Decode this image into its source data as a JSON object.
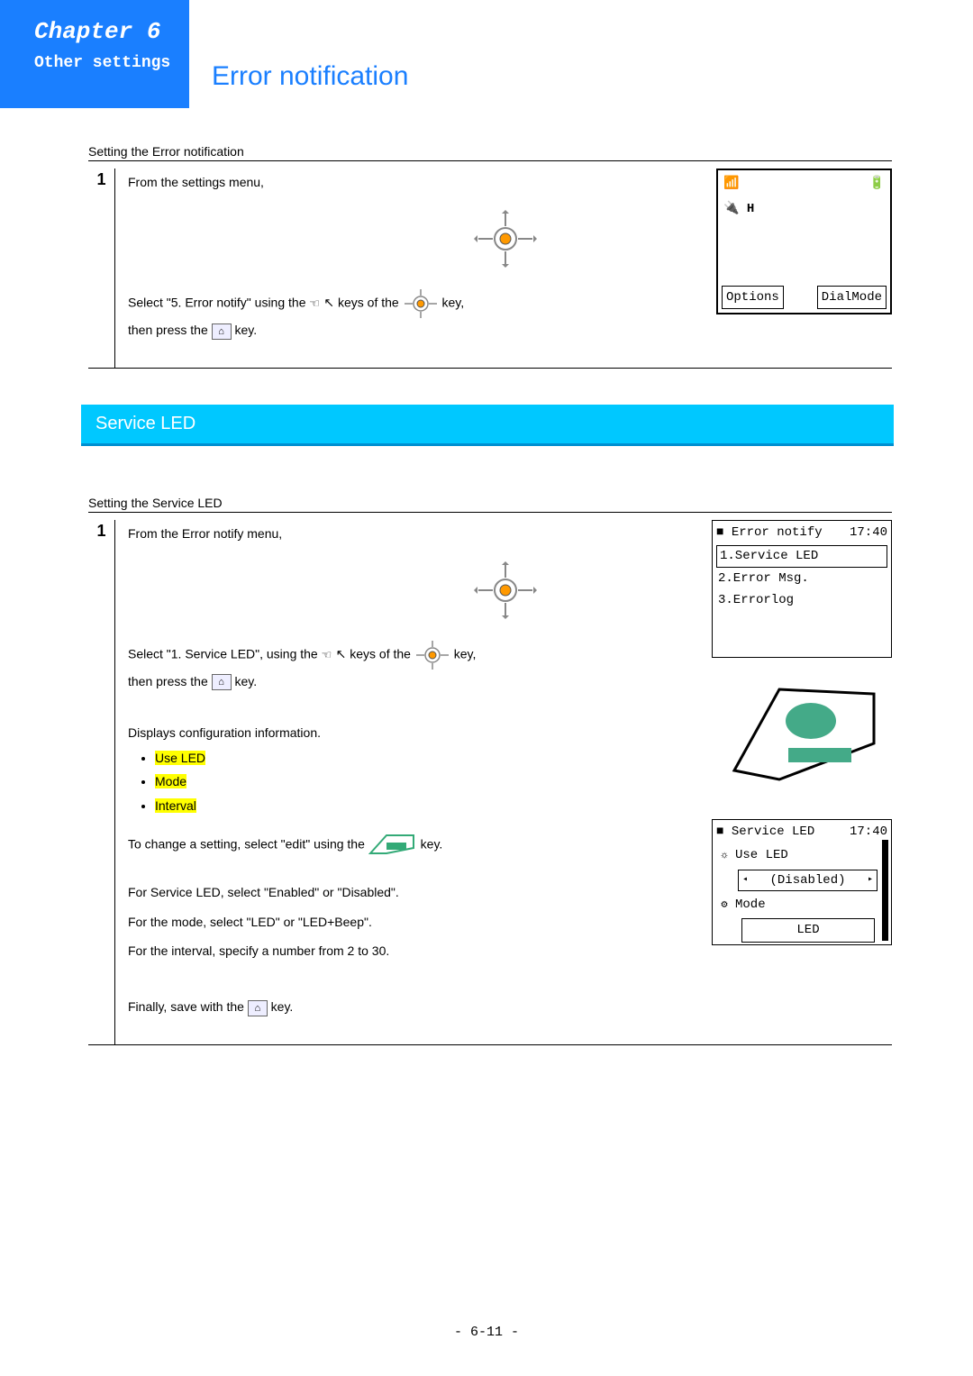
{
  "header": {
    "chapter": "Chapter 6",
    "subtitle": "Other settings",
    "main_title": "Error notification"
  },
  "section1": {
    "label": "Setting the Error notification",
    "step_num": "1",
    "line1": "From the settings menu,",
    "line2a": "Select \"5. Error notify\" using the ",
    "line2b": " keys of the ",
    "line2c": " key,",
    "line3a": "then press the ",
    "line3b": " key.",
    "screen": {
      "slot": "H",
      "btn_left": "Options",
      "btn_right": "DialMode"
    }
  },
  "blue_bar": "Service  LED",
  "section2": {
    "label": "Setting the Service LED",
    "step_num": "1",
    "line1": "From the Error notify menu,",
    "line2a": "Select \"1. Service LED\", using the ",
    "line2b": " keys of the ",
    "line2c": " key,",
    "line3a": "then press the ",
    "line3b": " key.",
    "disp": "Displays configuration information.",
    "bullets": [
      "Use LED",
      "Mode",
      "Interval"
    ],
    "change_a": "To change a setting, select \"edit\" using the ",
    "change_b": " key.",
    "l_serv": "For Service LED, select \"Enabled\" or \"Disabled\".",
    "l_mode": "For the mode, select \"LED\" or \"LED+Beep\".",
    "l_int": "For the interval, specify a number from 2 to 30.",
    "save_a": "Finally, save with the ",
    "save_b": " key.",
    "screen2": {
      "title": "Error notify",
      "time": "17:40",
      "items": [
        "1.Service LED",
        "2.Error Msg.",
        "3.Errorlog"
      ]
    },
    "screen3": {
      "title": "Service LED",
      "time": "17:40",
      "r1": "Use LED",
      "r1v": "(Disabled)",
      "r2": "Mode",
      "r2v": "LED"
    }
  },
  "page": "- 6-11 -"
}
